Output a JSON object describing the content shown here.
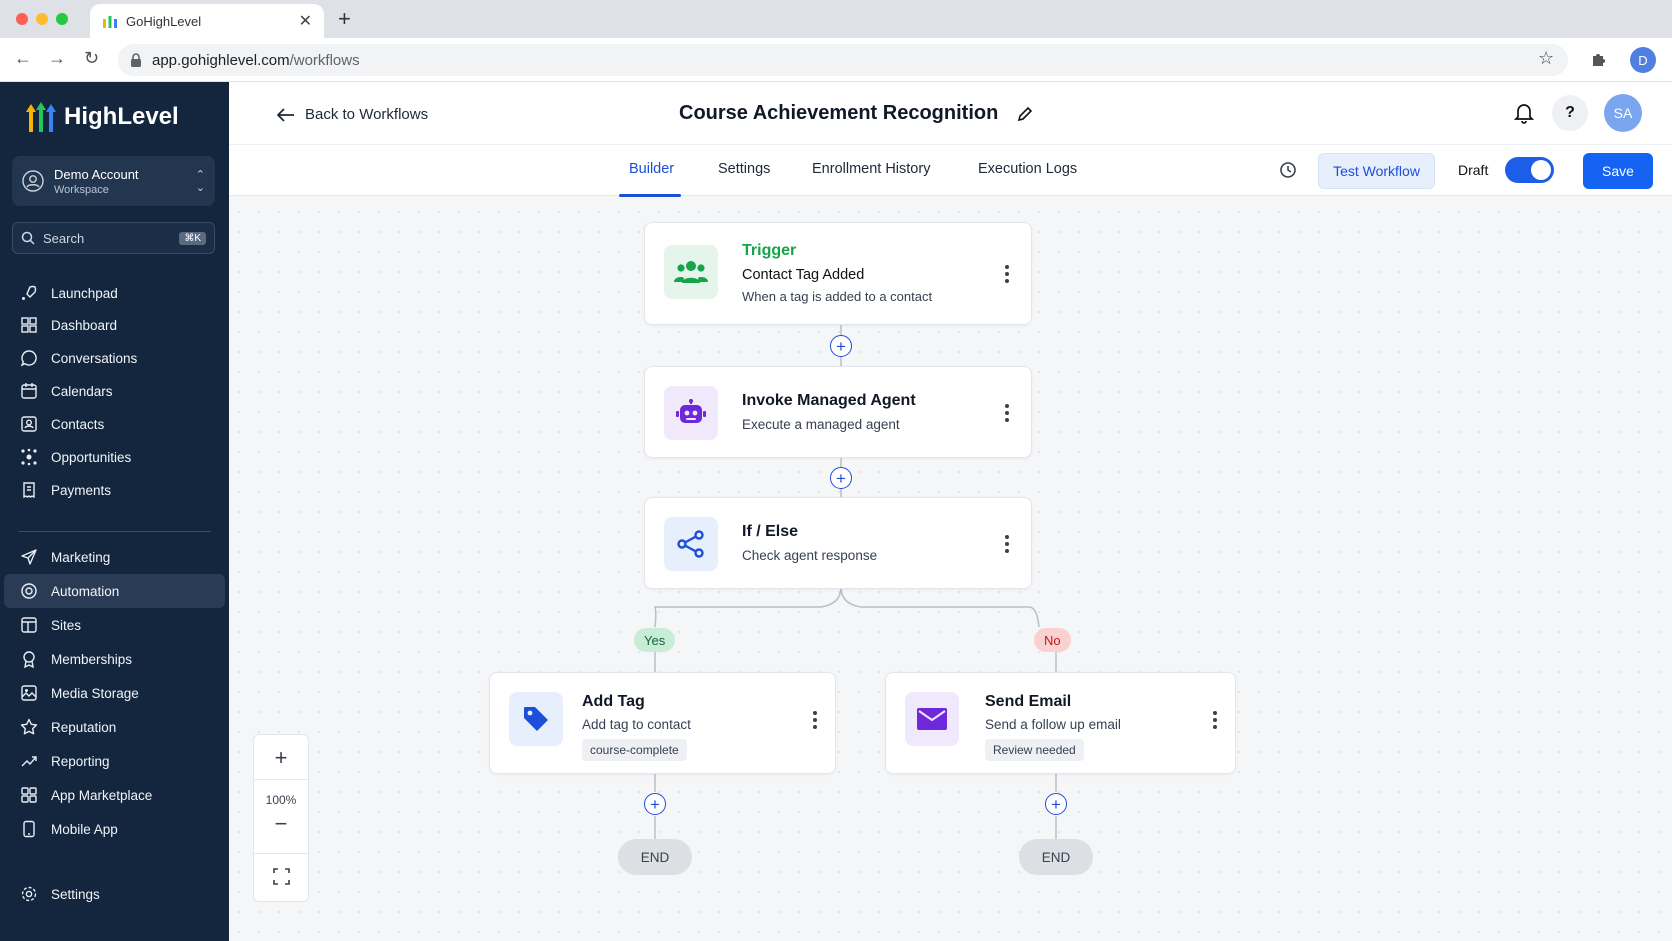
{
  "browser": {
    "tab_title": "GoHighLevel",
    "url_host": "app.gohighlevel.com",
    "url_path": "/workflows",
    "profile_initial": "D"
  },
  "sidebar": {
    "brand": "HighLevel",
    "account": {
      "name": "Demo Account",
      "subtitle": "Workspace"
    },
    "search": {
      "placeholder": "Search",
      "shortcut": "⌘K"
    },
    "items": [
      {
        "label": "Launchpad",
        "icon": "rocket-icon"
      },
      {
        "label": "Dashboard",
        "icon": "grid-icon"
      },
      {
        "label": "Conversations",
        "icon": "chat-icon"
      },
      {
        "label": "Calendars",
        "icon": "calendar-icon"
      },
      {
        "label": "Contacts",
        "icon": "contacts-icon"
      },
      {
        "label": "Opportunities",
        "icon": "opportunities-icon"
      },
      {
        "label": "Payments",
        "icon": "receipt-icon"
      },
      {
        "label": "Marketing",
        "icon": "send-icon"
      },
      {
        "label": "Automation",
        "icon": "automation-icon",
        "active": true
      },
      {
        "label": "Sites",
        "icon": "sites-icon"
      },
      {
        "label": "Memberships",
        "icon": "award-icon"
      },
      {
        "label": "Media Storage",
        "icon": "image-icon"
      },
      {
        "label": "Reputation",
        "icon": "star-icon"
      },
      {
        "label": "Reporting",
        "icon": "trend-icon"
      },
      {
        "label": "App Marketplace",
        "icon": "apps-icon"
      },
      {
        "label": "Mobile App",
        "icon": "phone-icon"
      },
      {
        "label": "Settings",
        "icon": "gear-icon"
      }
    ]
  },
  "header": {
    "back_label": "Back to Workflows",
    "title": "Course Achievement Recognition",
    "avatar_initials": "SA",
    "help_label": "?"
  },
  "tabs": {
    "items": [
      "Builder",
      "Settings",
      "Enrollment History",
      "Execution Logs"
    ],
    "active": "Builder",
    "test_label": "Test Workflow",
    "draft_label": "Draft",
    "draft_on": true,
    "save_label": "Save"
  },
  "workflow": {
    "trigger": {
      "kind": "Trigger",
      "title": "Contact Tag Added",
      "desc": "When a tag is added to a contact"
    },
    "agent": {
      "title": "Invoke Managed Agent",
      "desc": "Execute a managed agent"
    },
    "ifelse": {
      "title": "If / Else",
      "desc": "Check agent response"
    },
    "yes_label": "Yes",
    "no_label": "No",
    "add_tag": {
      "title": "Add Tag",
      "desc": "Add tag to contact",
      "chip": "course-complete"
    },
    "send_email": {
      "title": "Send Email",
      "desc": "Send a follow up email",
      "chip": "Review needed"
    },
    "end_label": "END"
  },
  "zoom": {
    "level": "100%"
  },
  "colors": {
    "sidebar_bg": "#14263e",
    "accent": "#1d4ed8",
    "trigger_green": "#16a34a",
    "agent_purple": "#6d28d9",
    "yes_bg": "#c8ecd6",
    "no_bg": "#fbd0d0"
  }
}
